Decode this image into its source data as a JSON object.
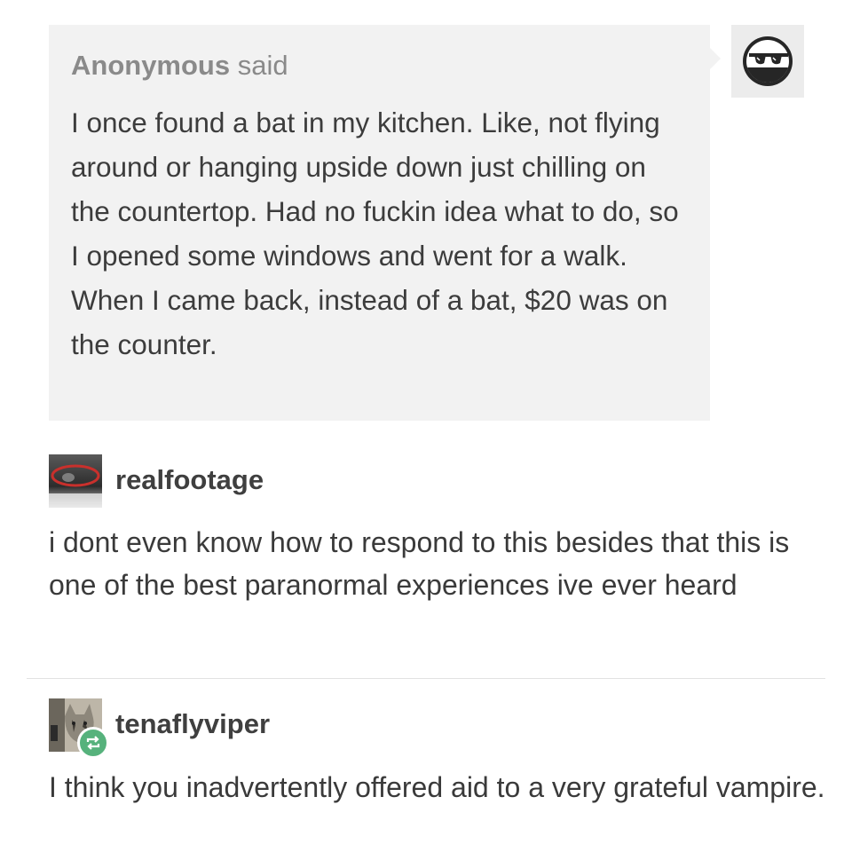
{
  "ask": {
    "sender": "Anonymous",
    "said": "said",
    "body": "I once found a bat in my kitchen. Like, not flying around or hanging upside down just chilling on the countertop. Had no fuckin idea what to do, so I opened some windows and went for a walk. When I came back, instead of a bat, $20 was on the counter.",
    "avatar_icon": "sunglasses-face-icon"
  },
  "replies": [
    {
      "username": "realfootage",
      "body": "i dont even know how to respond to this besides that this is one of the best paranormal experiences ive ever heard",
      "avatar_icon": "ghost-photo-avatar"
    },
    {
      "username": "tenaflyviper",
      "body": "I think you inadvertently offered aid to a very grateful vampire.",
      "avatar_icon": "cat-photo-avatar",
      "badge_icon": "reblog-icon"
    }
  ],
  "colors": {
    "ask_background": "#f2f2f2",
    "header_gray": "#8a8a8a",
    "text": "#3a3a3a",
    "reblog_green": "#56b27c"
  }
}
